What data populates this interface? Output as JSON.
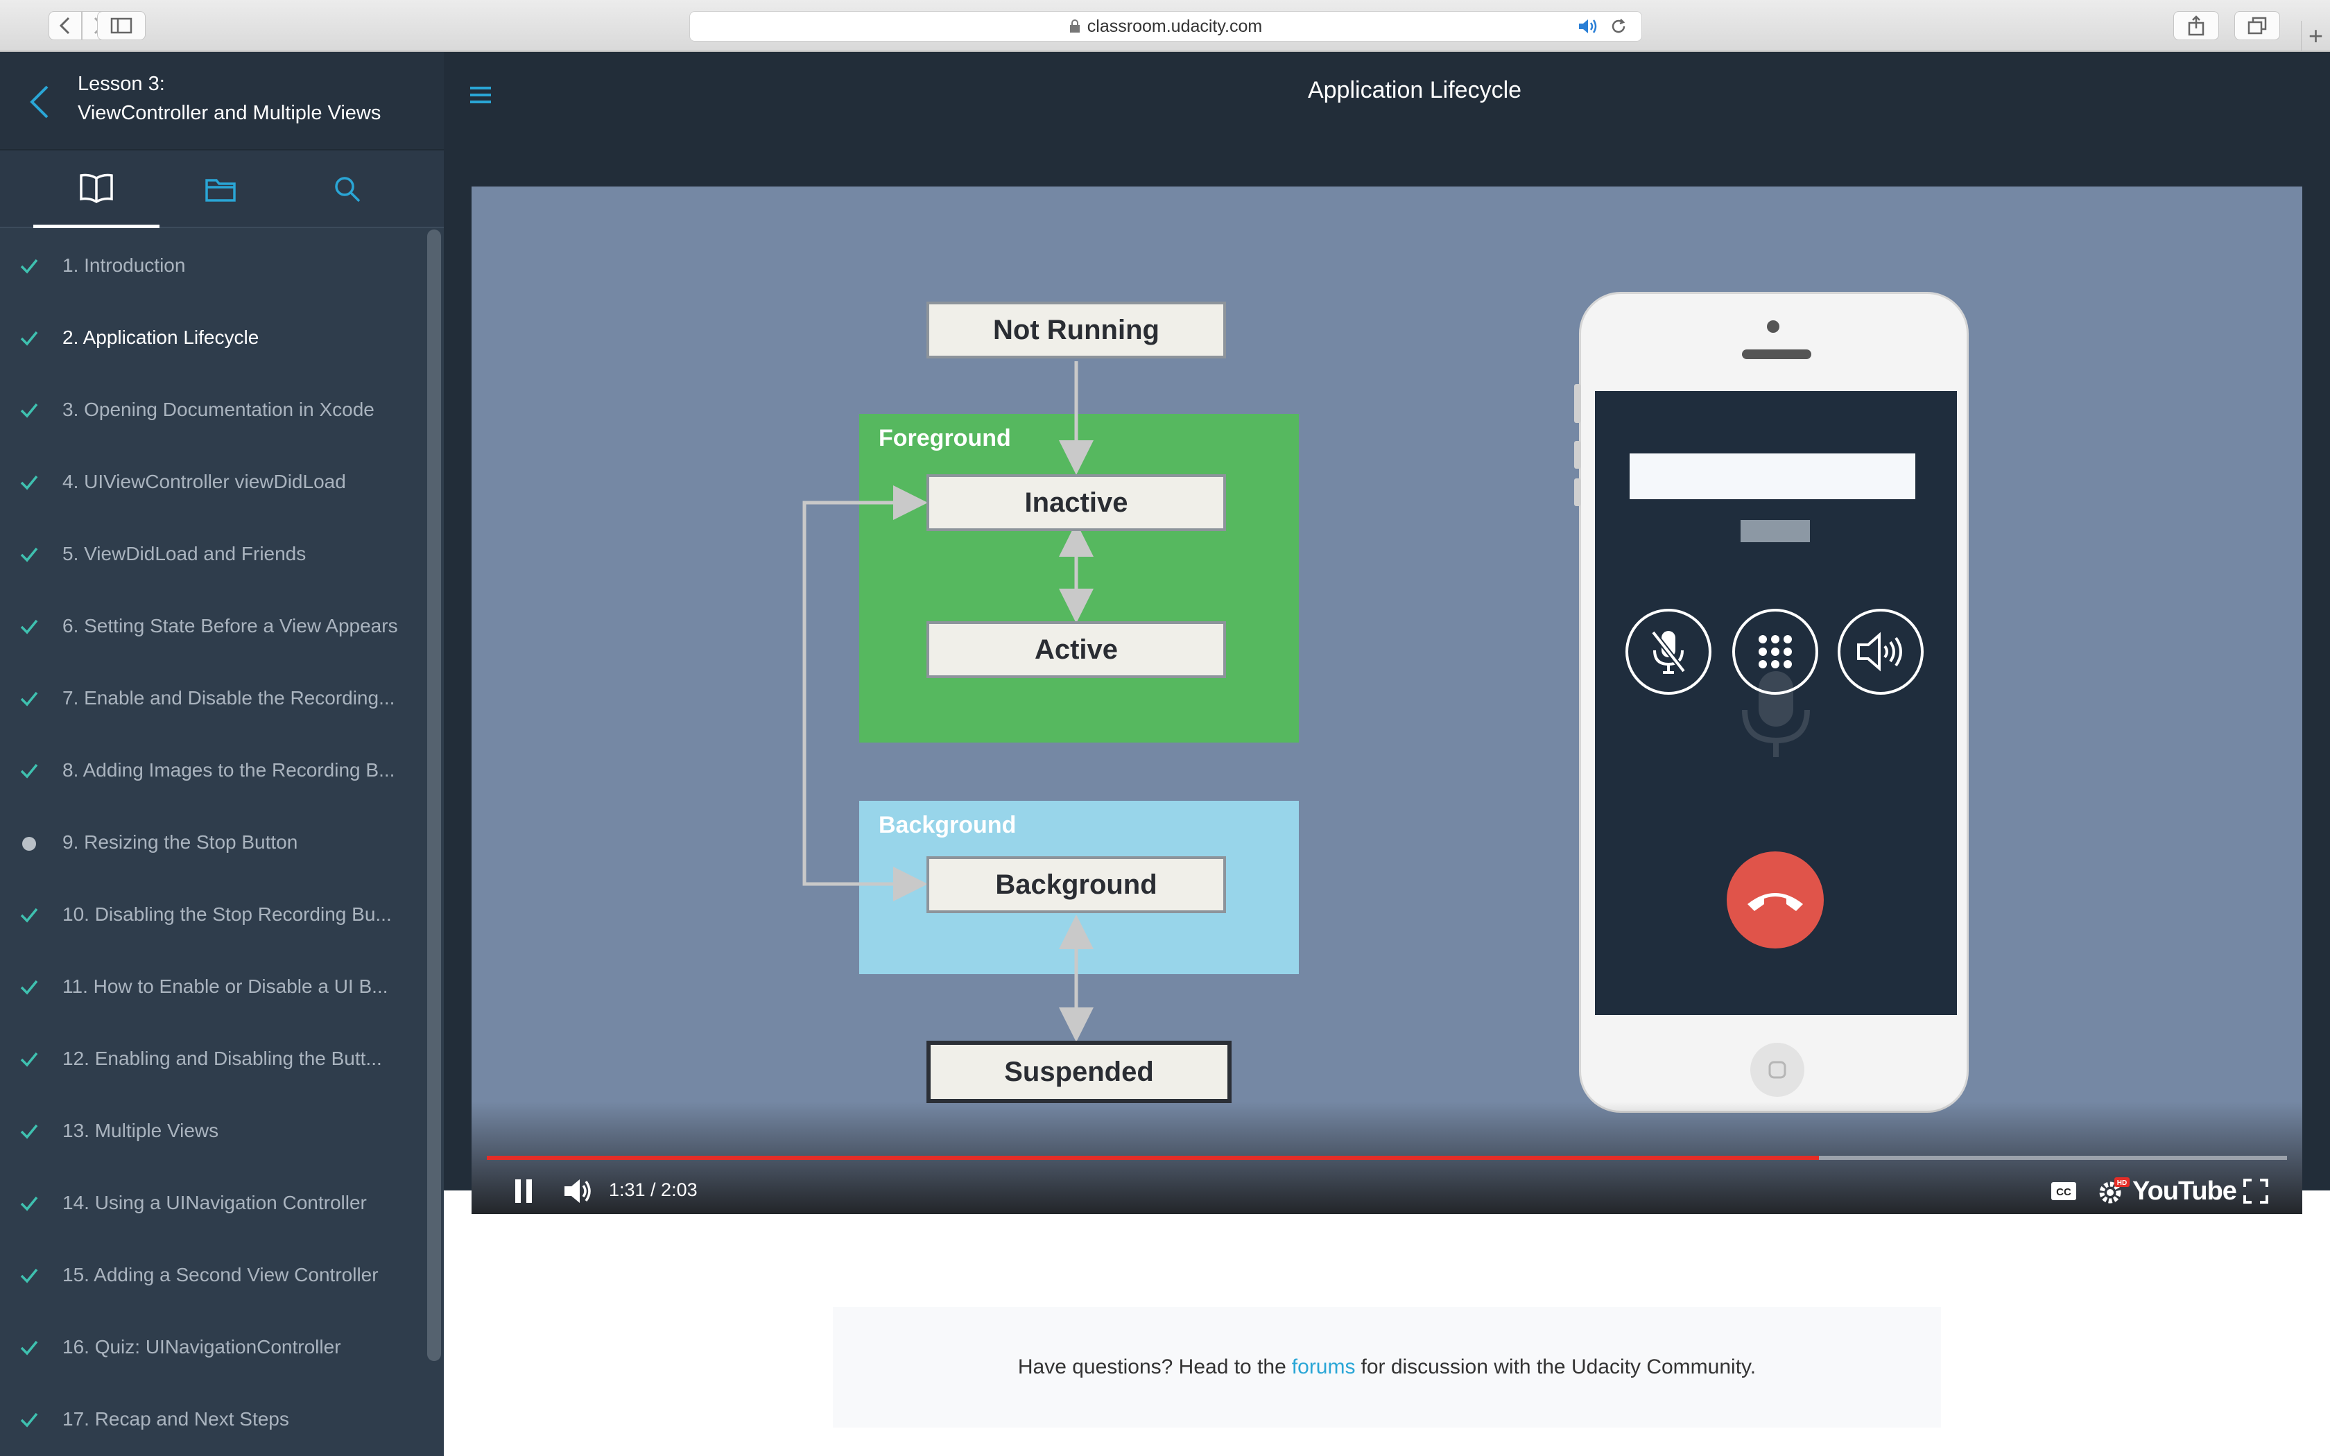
{
  "browser": {
    "url": "classroom.udacity.com",
    "icons": [
      "chevron-left-icon",
      "chevron-right-icon",
      "sidebar-icon",
      "lock-icon",
      "speaker-icon",
      "reload-icon",
      "share-icon",
      "tabs-icon",
      "plus-icon"
    ]
  },
  "sidebar": {
    "lesson_line1": "Lesson 3:",
    "lesson_line2": "ViewController and Multiple Views",
    "tabs": [
      "book-icon",
      "folder-icon",
      "search-icon"
    ],
    "items": [
      {
        "label": "1. Introduction",
        "status": "done"
      },
      {
        "label": "2. Application Lifecycle",
        "status": "done"
      },
      {
        "label": "3. Opening Documentation in Xcode",
        "status": "done"
      },
      {
        "label": "4. UIViewController viewDidLoad",
        "status": "done"
      },
      {
        "label": "5. ViewDidLoad and Friends",
        "status": "done"
      },
      {
        "label": "6. Setting State Before a View Appears",
        "status": "done"
      },
      {
        "label": "7. Enable and Disable the Recording...",
        "status": "done"
      },
      {
        "label": "8. Adding Images to the Recording B...",
        "status": "done"
      },
      {
        "label": "9. Resizing the Stop Button",
        "status": "current-dot"
      },
      {
        "label": "10. Disabling the Stop Recording Bu...",
        "status": "done"
      },
      {
        "label": "11. How to Enable or Disable a UI B...",
        "status": "done"
      },
      {
        "label": "12. Enabling and Disabling the Butt...",
        "status": "done"
      },
      {
        "label": "13. Multiple Views",
        "status": "done"
      },
      {
        "label": "14. Using a UINavigation Controller",
        "status": "done"
      },
      {
        "label": "15. Adding a Second View Controller",
        "status": "done"
      },
      {
        "label": "16. Quiz: UINavigationController",
        "status": "done"
      },
      {
        "label": "17. Recap and Next Steps",
        "status": "done"
      }
    ],
    "check_color": "#3fc1b0"
  },
  "main": {
    "title": "Application Lifecycle",
    "diagram": {
      "foreground_label": "Foreground",
      "background_label": "Background",
      "states": {
        "not_running": "Not Running",
        "inactive": "Inactive",
        "active": "Active",
        "background": "Background",
        "suspended": "Suspended"
      }
    },
    "player": {
      "time": "1:31 / 2:03",
      "progress": 0.74,
      "brand": "YouTube",
      "hd_badge": "HD"
    }
  },
  "footer": {
    "text_before": "Have questions? Head to the",
    "link": "forums",
    "text_after": "for discussion with the Udacity Community."
  },
  "colors": {
    "sidebar_bg": "#2f3d4c",
    "topbar_bg": "#222d39",
    "video_bg": "#7588a4",
    "foreground_green": "#56b85f",
    "background_blue": "#98d5ea",
    "accent_blue": "#2aa6d6",
    "progress_red": "#e52d27"
  }
}
